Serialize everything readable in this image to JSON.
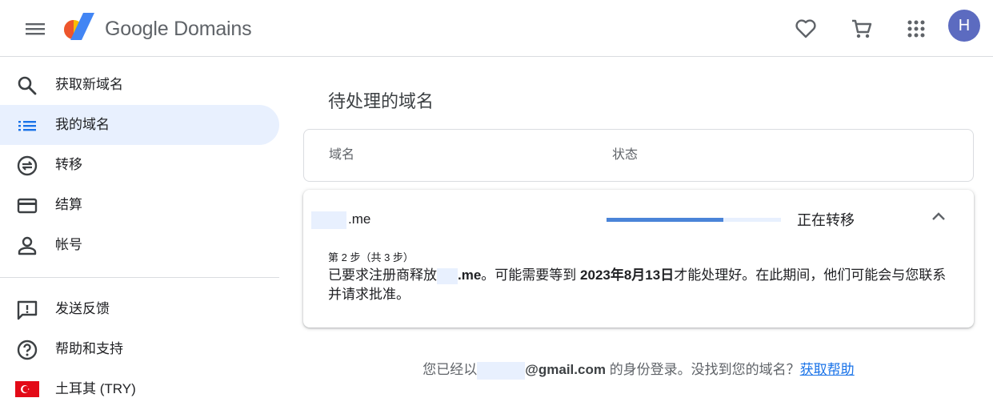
{
  "header": {
    "brand": "Google Domains",
    "avatar_letter": "H",
    "icons": [
      "menu-icon",
      "google-domains-logo",
      "heart-icon",
      "cart-icon",
      "apps-grid-icon"
    ]
  },
  "sidebar": {
    "items": [
      {
        "label": "获取新域名",
        "icon": "search-icon"
      },
      {
        "label": "我的域名",
        "icon": "list-icon",
        "active": true
      },
      {
        "label": "转移",
        "icon": "transfer-icon"
      },
      {
        "label": "结算",
        "icon": "credit-card-icon"
      },
      {
        "label": "帐号",
        "icon": "person-icon"
      }
    ],
    "secondary": [
      {
        "label": "发送反馈",
        "icon": "feedback-icon"
      },
      {
        "label": "帮助和支持",
        "icon": "help-icon"
      },
      {
        "label": "土耳其 (TRY)",
        "icon": "turkey-flag-icon"
      }
    ]
  },
  "main": {
    "title": "待处理的域名",
    "columns": {
      "domain": "域名",
      "status": "状态"
    },
    "domain": {
      "name_suffix": ".me",
      "status": "正在转移",
      "progress": 0.67,
      "step": "第 2 步（共 3 步）",
      "desc_prefix": "已要求注册商释放",
      "desc_domain": ".me",
      "desc_mid": "。可能需要等到",
      "desc_date": "2023年8月13日",
      "desc_suffix": "才能处理好。在此期间，他们可能会与您联系并请求批准。"
    },
    "footer": {
      "prefix": "您已经以",
      "email": "@gmail.com",
      "suffix": "的身份登录。没找到您的域名？",
      "help_link": "获取帮助"
    }
  },
  "colors": {
    "accent": "#1a73e8",
    "active_bg": "#e8f0fe",
    "avatar": "#5c6bc0",
    "progress": "#4a84d8"
  }
}
